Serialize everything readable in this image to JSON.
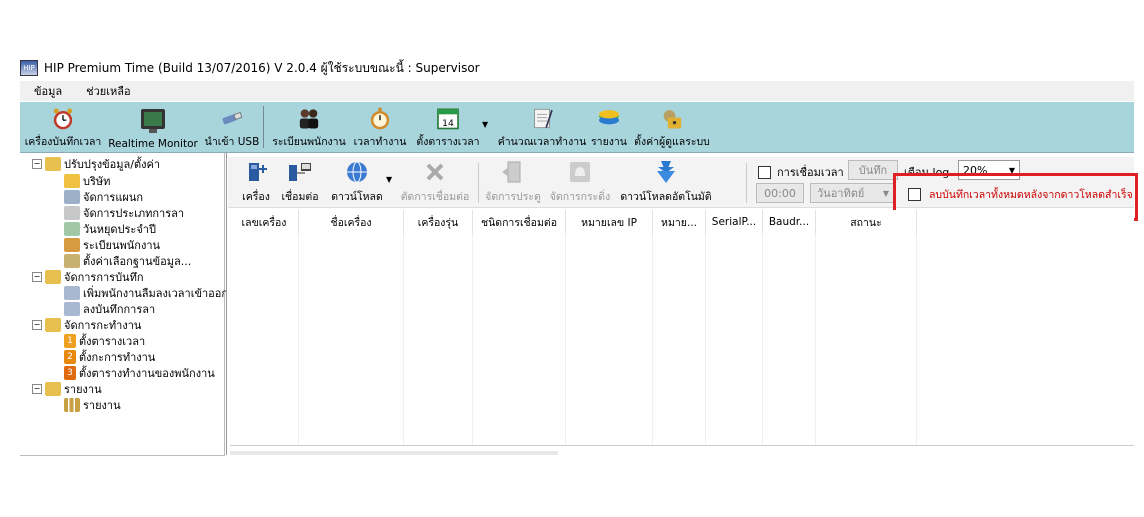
{
  "window": {
    "title": "HIP Premium Time (Build 13/07/2016) V 2.0.4   ผู้ใช้ระบบขณะนี้ : Supervisor"
  },
  "menu": {
    "items": [
      "ข้อมูล",
      "ช่วยเหลือ"
    ]
  },
  "toolbar": {
    "items": [
      {
        "label": "เครื่องบันทึกเวลา",
        "icon": "clock-icon"
      },
      {
        "label": "Realtime Monitor",
        "icon": "monitor-icon"
      },
      {
        "label": "นำเข้า USB",
        "icon": "usb-icon"
      },
      {
        "label": "ระเบียนพนักงาน",
        "icon": "employees-icon"
      },
      {
        "label": "เวลาทำงาน",
        "icon": "stopwatch-icon"
      },
      {
        "label": "ตั้งตารางเวลา",
        "icon": "calendar-icon"
      },
      {
        "label": "คำนวณเวลาทำงาน",
        "icon": "calculate-icon"
      },
      {
        "label": "รายงาน",
        "icon": "report-icon"
      },
      {
        "label": "ตั้งค่าผู้ดูแลระบบ",
        "icon": "admin-lock-icon"
      }
    ],
    "calendar_day": "14"
  },
  "tree": {
    "groups": [
      {
        "label": "ปรับปรุงข้อมูล/ตั้งค่า",
        "children": [
          "บริษัท",
          "จัดการแผนก",
          "จัดการประเภทการลา",
          "วันหยุดประจำปี",
          "ระเบียนพนักงาน",
          "ตั้งค่าเลือกฐานข้อมูล..."
        ]
      },
      {
        "label": "จัดการการบันทึก",
        "children": [
          "เพิ่มพนักงานลืมลงเวลาเข้าออก",
          "ลงบันทึกการลา"
        ]
      },
      {
        "label": "จัดการกะทำงาน",
        "children": [
          "ตั้งตารางเวลา",
          "ตั้งกะการทำงาน",
          "ตั้งตารางทำงานของพนักงาน"
        ]
      },
      {
        "label": "รายงาน",
        "children": [
          "รายงาน"
        ]
      }
    ],
    "badges": [
      "1",
      "2",
      "3"
    ]
  },
  "subtoolbar": {
    "items": [
      {
        "label": "เครื่อง",
        "enabled": true
      },
      {
        "label": "เชื่อมต่อ",
        "enabled": true
      },
      {
        "label": "ดาวน์โหลด",
        "enabled": true
      },
      {
        "label": "ตัดการเชื่อมต่อ",
        "enabled": false
      },
      {
        "label": "จัดการประตู",
        "enabled": false
      },
      {
        "label": "จัดการกระดิ่ง",
        "enabled": false
      },
      {
        "label": "ดาวน์โหลดอัตโนมัติ",
        "enabled": true
      }
    ]
  },
  "controls": {
    "time_sync_label": "การเชื่อมเวลา",
    "save_label": "บันทึก",
    "log_label": "เตือน log",
    "log_percent": "20%",
    "time_value": "00:00",
    "weekday_value": "วันอาทิตย์",
    "delete_after_download_label": "ลบบันทึกเวลาทั้งหมดหลังจากดาวโหลดสำเร็จ"
  },
  "grid": {
    "columns": [
      "เลขเครื่อง",
      "ชื่อเครื่อง",
      "เครื่องรุ่น",
      "ชนิดการเชื่อมต่อ",
      "หมายเลข IP",
      "หมาย...",
      "SerialP...",
      "Baudr...",
      "สถานะ"
    ]
  },
  "colors": {
    "toolbar_bg": "#a8d4dc",
    "highlight": "#e02020",
    "badge": "#f0a020"
  }
}
